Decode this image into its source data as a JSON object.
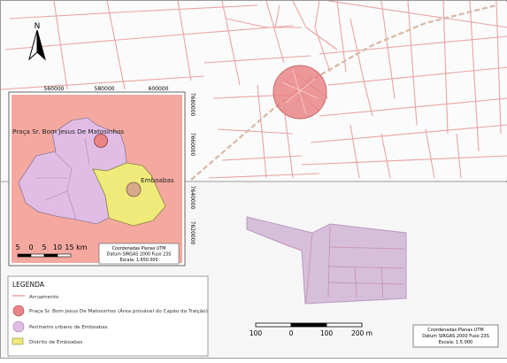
{
  "north_arrow": {
    "label": "N"
  },
  "inset": {
    "x_ticks": [
      "560000",
      "580000",
      "600000"
    ],
    "y_ticks": [
      "7680000",
      "7660000",
      "7640000",
      "7620000"
    ],
    "labels": {
      "praca": "Praça Sr. Bom Jesus De Matosinhos",
      "emboabas": "Emboabas"
    },
    "scale_labels": [
      "5",
      "0",
      "5",
      "10",
      "15 km"
    ],
    "coord_box": {
      "line1": "Coordenadas Planas UTM",
      "line2": "Datum SIRGAS 2000 Fuso 23S",
      "line3": "Escala: 1:650.000"
    }
  },
  "legend": {
    "title": "LEGENDA",
    "items": [
      {
        "label": "Arruamento",
        "symbol": "line",
        "color": "#e89a9a"
      },
      {
        "label": "Praça Sr. Bom Jesus De Matosinhos (Área provável do Capão da Traição)",
        "symbol": "circle",
        "color": "#e98586"
      },
      {
        "label": "Perímetro urbano de Emboabas",
        "symbol": "circle",
        "color": "#e1bde6"
      },
      {
        "label": "Distrito de Emboabas",
        "symbol": "rect",
        "color": "#f0ea7a"
      }
    ]
  },
  "main_scale": {
    "labels": [
      "100",
      "0",
      "100",
      "200 m"
    ]
  },
  "main_coord_box": {
    "line1": "Coordenadas Planas UTM",
    "line2": "Datum SIRGAS 2000 Fuso 23S",
    "line3": "Escala: 1:5.000"
  },
  "colors": {
    "street": "#e8a0a0",
    "inset_bg": "#f4a8a0",
    "district": "#f0ea7a",
    "urban": "#e1bde6",
    "praca": "#e98586"
  }
}
